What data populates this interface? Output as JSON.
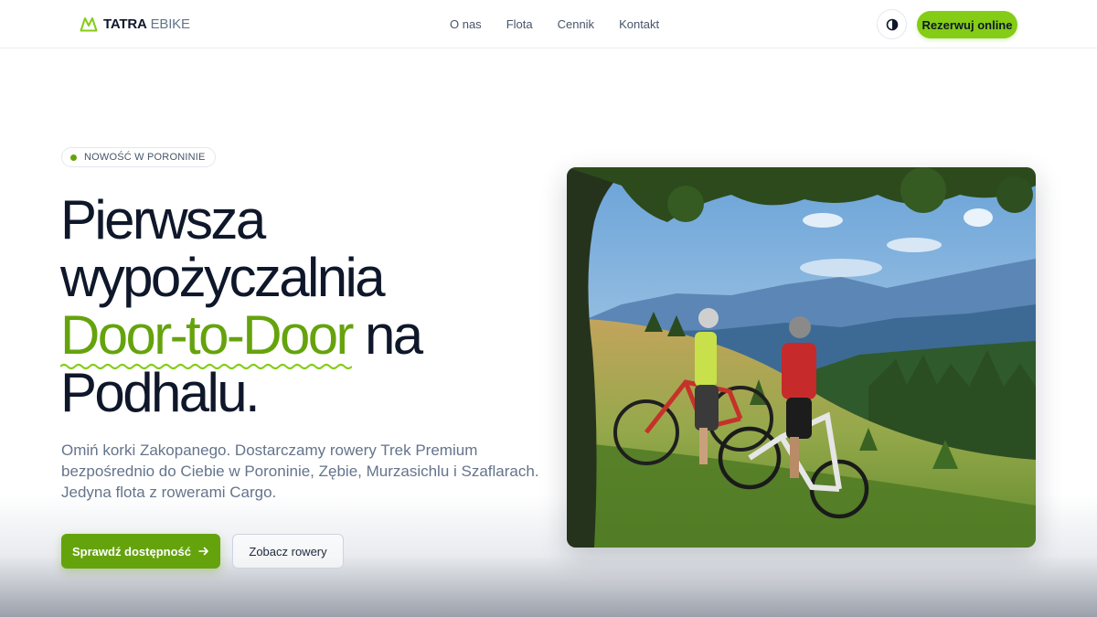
{
  "brand": {
    "name_bold": "TATRA",
    "name_light": "EBIKE",
    "logo_icon": "mountain-icon",
    "accent_color": "#84cc16",
    "accent_dark": "#65a30d"
  },
  "nav": {
    "items": [
      {
        "label": "O nas"
      },
      {
        "label": "Flota"
      },
      {
        "label": "Cennik"
      },
      {
        "label": "Kontakt"
      }
    ]
  },
  "header": {
    "theme_toggle_icon": "contrast-icon",
    "cta_label": "Rezerwuj online"
  },
  "hero": {
    "badge": "NOWOŚĆ W PORONINIE",
    "headline": {
      "line1": "Pierwsza",
      "line2": "wypożyczalnia",
      "accent": "Door-to-Door",
      "after_accent": " na",
      "line4": "Podhalu."
    },
    "description": "Omiń korki Zakopanego. Dostarczamy rowery Trek Premium bezpośrednio do Ciebie w Poroninie, Zębie, Murzasichlu i Szaflarach. Jedyna flota z rowerami Cargo.",
    "primary_button": "Sprawdź dostępność",
    "primary_button_icon": "arrow-right-icon",
    "secondary_button": "Zobacz rowery",
    "image_subject": "two-cyclists-mountain-meadow"
  }
}
